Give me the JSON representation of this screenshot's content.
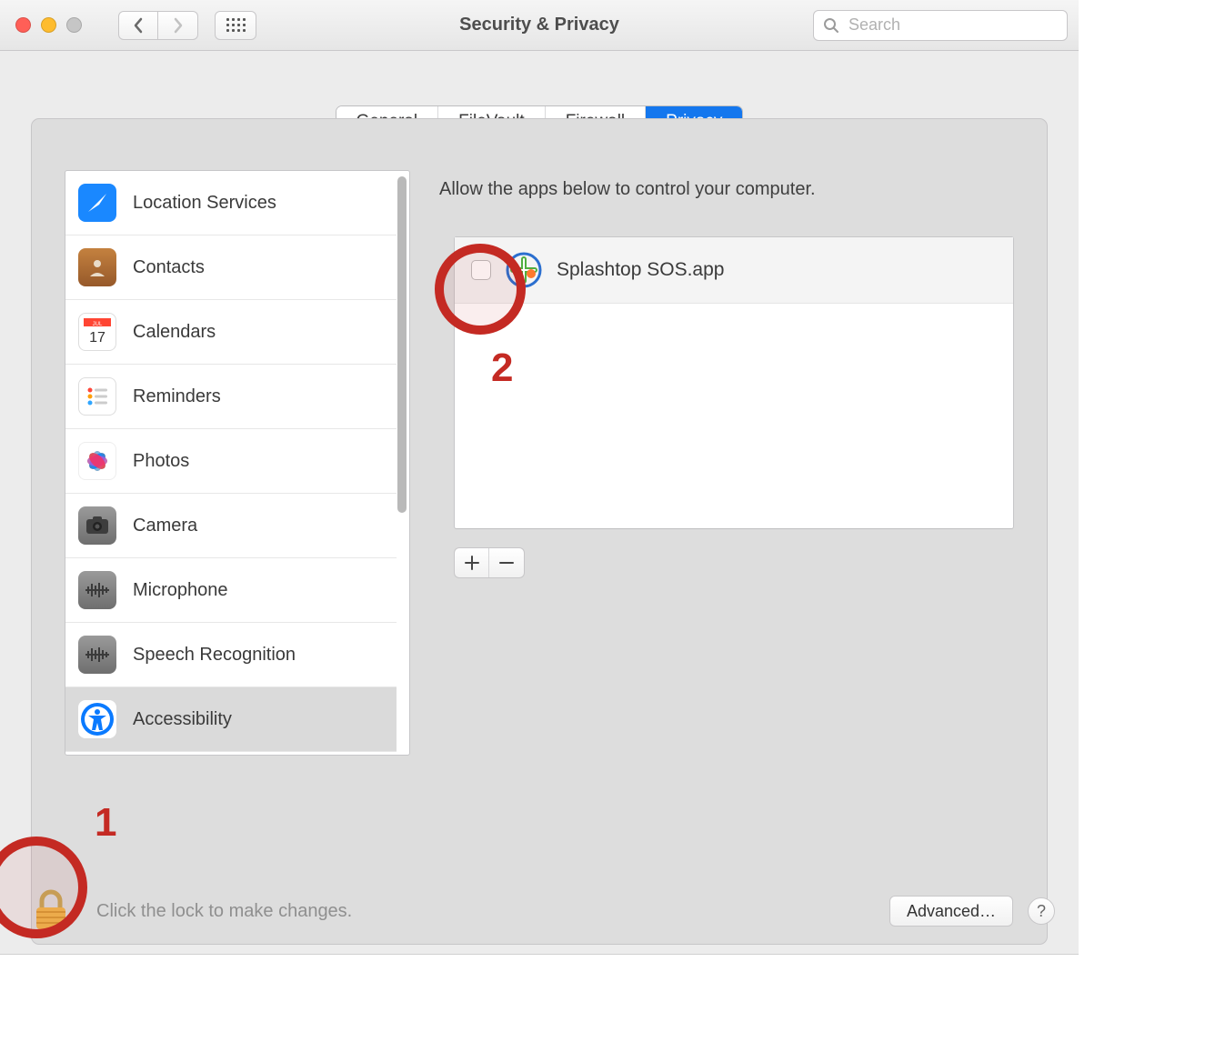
{
  "window": {
    "title": "Security & Privacy"
  },
  "search": {
    "placeholder": "Search"
  },
  "tabs": [
    {
      "label": "General",
      "active": false
    },
    {
      "label": "FileVault",
      "active": false
    },
    {
      "label": "Firewall",
      "active": false
    },
    {
      "label": "Privacy",
      "active": true
    }
  ],
  "sidebar": {
    "items": [
      {
        "label": "Location Services",
        "icon": "location-icon",
        "selected": false
      },
      {
        "label": "Contacts",
        "icon": "contacts-icon",
        "selected": false
      },
      {
        "label": "Calendars",
        "icon": "calendar-icon",
        "selected": false
      },
      {
        "label": "Reminders",
        "icon": "reminders-icon",
        "selected": false
      },
      {
        "label": "Photos",
        "icon": "photos-icon",
        "selected": false
      },
      {
        "label": "Camera",
        "icon": "camera-icon",
        "selected": false
      },
      {
        "label": "Microphone",
        "icon": "microphone-icon",
        "selected": false
      },
      {
        "label": "Speech Recognition",
        "icon": "speech-icon",
        "selected": false
      },
      {
        "label": "Accessibility",
        "icon": "accessibility-icon",
        "selected": true
      }
    ]
  },
  "content": {
    "prompt": "Allow the apps below to control your computer.",
    "apps": [
      {
        "name": "Splashtop SOS.app",
        "checked": false
      }
    ]
  },
  "footer": {
    "lock_msg": "Click the lock to make changes.",
    "advanced_label": "Advanced…",
    "help_label": "?"
  },
  "annotations": {
    "n1": "1",
    "n2": "2"
  }
}
